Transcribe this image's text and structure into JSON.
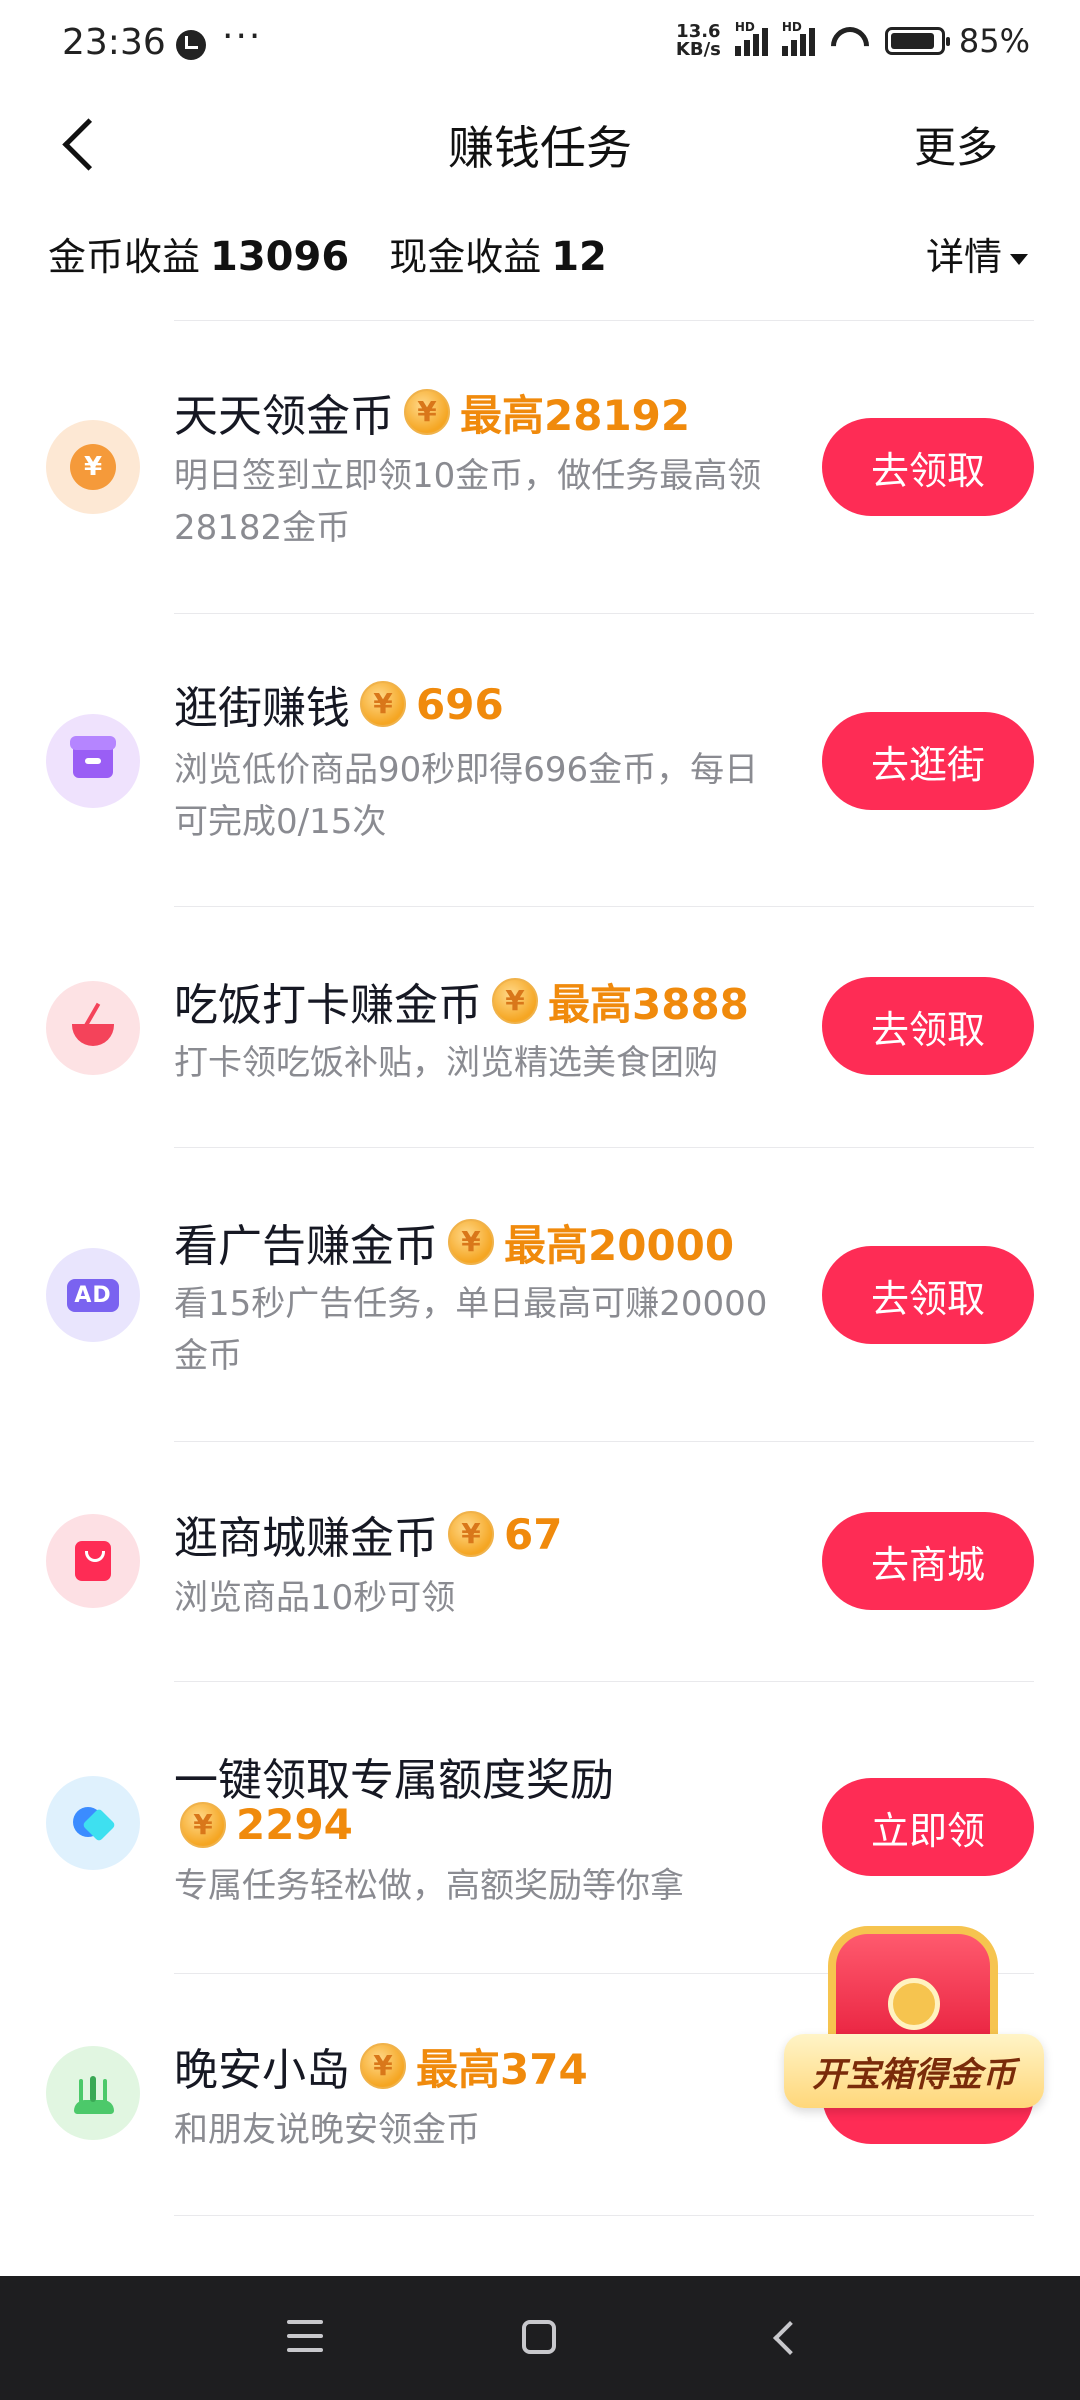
{
  "status_bar": {
    "time": "23:36",
    "more": "···",
    "net_speed_value": "13.6",
    "net_speed_unit": "KB/s",
    "sim1_tag": "HD",
    "sim2_tag": "HD",
    "battery_percent": "85%",
    "icons": [
      "clock-notification-icon",
      "signal-icon",
      "wifi-icon",
      "battery-icon"
    ]
  },
  "header": {
    "title": "赚钱任务",
    "more_label": "更多"
  },
  "earnings": {
    "coin_label": "金币收益",
    "coin_value": "13096",
    "cash_label": "现金收益",
    "cash_value": "12",
    "detail_label": "详情"
  },
  "tasks": [
    {
      "title": "天天领金币",
      "reward": "最高28192",
      "desc": "明日签到立即领10金币，做任务最高领28182金币",
      "button": "去领取",
      "icon": "yen-coin-icon"
    },
    {
      "title": "逛街赚钱",
      "reward": "696",
      "desc": "浏览低价商品90秒即得696金币，每日可完成0/15次",
      "button": "去逛街",
      "icon": "shop-icon"
    },
    {
      "title": "吃饭打卡赚金币",
      "reward": "最高3888",
      "desc": "打卡领吃饭补贴，浏览精选美食团购",
      "button": "去领取",
      "icon": "bowl-icon"
    },
    {
      "title": "看广告赚金币",
      "reward": "最高20000",
      "desc": "看15秒广告任务，单日最高可赚20000金币",
      "button": "去领取",
      "icon": "ad-icon"
    },
    {
      "title": "逛商城赚金币",
      "reward": "67",
      "desc": "浏览商品10秒可领",
      "button": "去商城",
      "icon": "shopping-bag-icon"
    },
    {
      "title": "一键领取专属额度奖励",
      "reward": "2294",
      "desc": "专属任务轻松做，高额奖励等你拿",
      "button": "立即领",
      "icon": "heart-gem-icon"
    },
    {
      "title": "晚安小岛",
      "reward": "最高374",
      "desc": "和朋友说晚安领金币",
      "button": "",
      "icon": "island-icon"
    }
  ],
  "treasure_chest": {
    "label": "开宝箱得金币"
  },
  "colors": {
    "accent": "#fe2c55",
    "reward": "#f08a0c",
    "secondary_text": "#8a8b91"
  }
}
